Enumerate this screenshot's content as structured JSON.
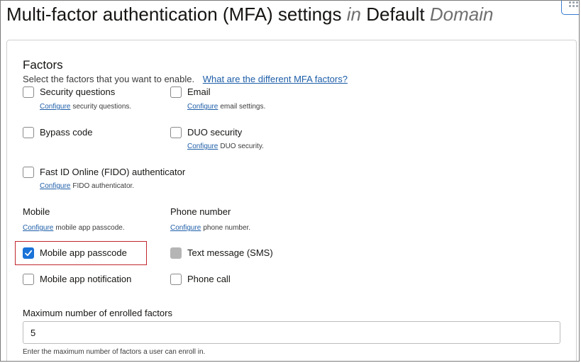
{
  "header": {
    "title_prefix": "Multi-factor authentication (MFA) settings",
    "title_in": "in",
    "title_domain": "Default",
    "title_domain_suffix": "Domain"
  },
  "factors": {
    "title": "Factors",
    "description": "Select the factors that you want to enable.",
    "help_link": "What are the different MFA factors?",
    "configure_label": "Configure",
    "items": {
      "security_questions": {
        "label": "Security questions",
        "hint": "security questions.",
        "checked": false
      },
      "email": {
        "label": "Email",
        "hint": "email settings.",
        "checked": false
      },
      "bypass_code": {
        "label": "Bypass code",
        "checked": false
      },
      "duo_security": {
        "label": "DUO security",
        "hint": "DUO security.",
        "checked": false
      },
      "fido": {
        "label": "Fast ID Online (FIDO) authenticator",
        "hint": "FIDO authenticator.",
        "checked": false
      }
    }
  },
  "mobile": {
    "title": "Mobile",
    "hint": "mobile app passcode.",
    "passcode": {
      "label": "Mobile app passcode",
      "checked": true
    },
    "notification": {
      "label": "Mobile app notification",
      "checked": false
    }
  },
  "phone": {
    "title": "Phone number",
    "hint": "phone number.",
    "sms": {
      "label": "Text message (SMS)",
      "checked": true,
      "disabled": true
    },
    "call": {
      "label": "Phone call",
      "checked": false
    }
  },
  "max_factors": {
    "label": "Maximum number of enrolled factors",
    "value": "5",
    "help": "Enter the maximum number of factors a user can enroll in."
  },
  "colors": {
    "accent": "#1a73d9",
    "link": "#1e5ea8",
    "highlight": "#c0272d"
  }
}
